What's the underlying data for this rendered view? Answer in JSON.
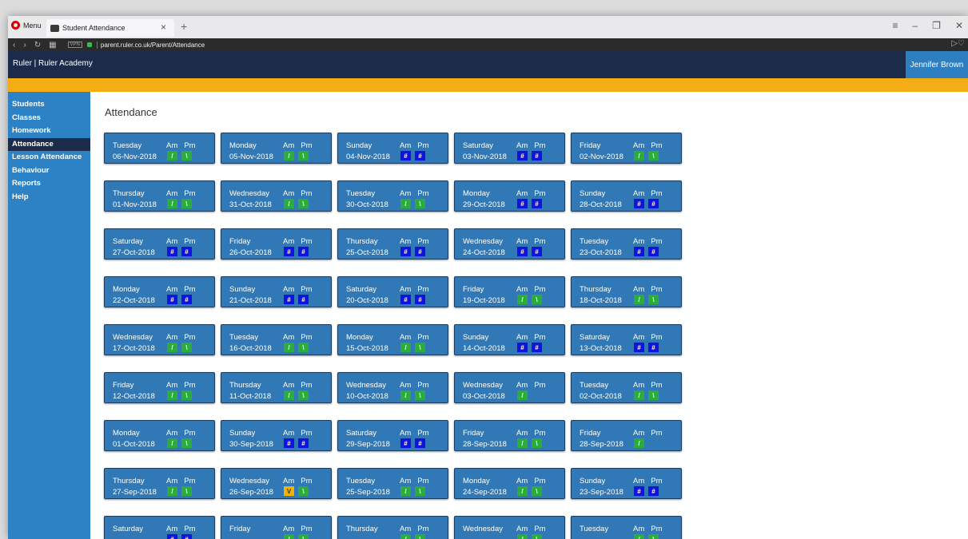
{
  "browser": {
    "menu_label": "Menu",
    "tab_title": "Student Attendance",
    "close_glyph": "×",
    "new_tab_glyph": "+",
    "url": "parent.ruler.co.uk/Parent/Attendance",
    "vpn_label": "VPN"
  },
  "app": {
    "brand": "Ruler | Ruler Academy",
    "user": "Jennifer Brown",
    "accent_color": "#f5ad16",
    "header_color": "#1d2b4a",
    "sidebar_color": "#2d82c6"
  },
  "sidebar": {
    "items": [
      {
        "label": "Students"
      },
      {
        "label": "Classes"
      },
      {
        "label": "Homework"
      },
      {
        "label": "Attendance",
        "active": true
      },
      {
        "label": "Lesson Attendance"
      },
      {
        "label": "Behaviour"
      },
      {
        "label": "Reports"
      },
      {
        "label": "Help"
      }
    ]
  },
  "page": {
    "title": "Attendance",
    "am_label": "Am",
    "pm_label": "Pm"
  },
  "cards": [
    {
      "day": "Tuesday",
      "date": "06-Nov-2018",
      "am": "/",
      "pm": "\\"
    },
    {
      "day": "Monday",
      "date": "05-Nov-2018",
      "am": "/",
      "pm": "\\"
    },
    {
      "day": "Sunday",
      "date": "04-Nov-2018",
      "am": "#",
      "pm": "#"
    },
    {
      "day": "Saturday",
      "date": "03-Nov-2018",
      "am": "#",
      "pm": "#"
    },
    {
      "day": "Friday",
      "date": "02-Nov-2018",
      "am": "/",
      "pm": "\\"
    },
    {
      "day": "Thursday",
      "date": "01-Nov-2018",
      "am": "/",
      "pm": "\\"
    },
    {
      "day": "Wednesday",
      "date": "31-Oct-2018",
      "am": "/",
      "pm": "\\"
    },
    {
      "day": "Tuesday",
      "date": "30-Oct-2018",
      "am": "/",
      "pm": "\\"
    },
    {
      "day": "Monday",
      "date": "29-Oct-2018",
      "am": "#",
      "pm": "#"
    },
    {
      "day": "Sunday",
      "date": "28-Oct-2018",
      "am": "#",
      "pm": "#"
    },
    {
      "day": "Saturday",
      "date": "27-Oct-2018",
      "am": "#",
      "pm": "#"
    },
    {
      "day": "Friday",
      "date": "26-Oct-2018",
      "am": "#",
      "pm": "#"
    },
    {
      "day": "Thursday",
      "date": "25-Oct-2018",
      "am": "#",
      "pm": "#"
    },
    {
      "day": "Wednesday",
      "date": "24-Oct-2018",
      "am": "#",
      "pm": "#"
    },
    {
      "day": "Tuesday",
      "date": "23-Oct-2018",
      "am": "#",
      "pm": "#"
    },
    {
      "day": "Monday",
      "date": "22-Oct-2018",
      "am": "#",
      "pm": "#"
    },
    {
      "day": "Sunday",
      "date": "21-Oct-2018",
      "am": "#",
      "pm": "#"
    },
    {
      "day": "Saturday",
      "date": "20-Oct-2018",
      "am": "#",
      "pm": "#"
    },
    {
      "day": "Friday",
      "date": "19-Oct-2018",
      "am": "/",
      "pm": "\\"
    },
    {
      "day": "Thursday",
      "date": "18-Oct-2018",
      "am": "/",
      "pm": "\\"
    },
    {
      "day": "Wednesday",
      "date": "17-Oct-2018",
      "am": "/",
      "pm": "\\"
    },
    {
      "day": "Tuesday",
      "date": "16-Oct-2018",
      "am": "/",
      "pm": "\\"
    },
    {
      "day": "Monday",
      "date": "15-Oct-2018",
      "am": "/",
      "pm": "\\"
    },
    {
      "day": "Sunday",
      "date": "14-Oct-2018",
      "am": "#",
      "pm": "#"
    },
    {
      "day": "Saturday",
      "date": "13-Oct-2018",
      "am": "#",
      "pm": "#"
    },
    {
      "day": "Friday",
      "date": "12-Oct-2018",
      "am": "/",
      "pm": "\\"
    },
    {
      "day": "Thursday",
      "date": "11-Oct-2018",
      "am": "/",
      "pm": "\\"
    },
    {
      "day": "Wednesday",
      "date": "10-Oct-2018",
      "am": "/",
      "pm": "\\"
    },
    {
      "day": "Wednesday",
      "date": "03-Oct-2018",
      "am": "/",
      "pm": ""
    },
    {
      "day": "Tuesday",
      "date": "02-Oct-2018",
      "am": "/",
      "pm": "\\"
    },
    {
      "day": "Monday",
      "date": "01-Oct-2018",
      "am": "/",
      "pm": "\\"
    },
    {
      "day": "Sunday",
      "date": "30-Sep-2018",
      "am": "#",
      "pm": "#"
    },
    {
      "day": "Saturday",
      "date": "29-Sep-2018",
      "am": "#",
      "pm": "#"
    },
    {
      "day": "Friday",
      "date": "28-Sep-2018",
      "am": "/",
      "pm": "\\"
    },
    {
      "day": "Friday",
      "date": "28-Sep-2018",
      "am": "/",
      "pm": ""
    },
    {
      "day": "Thursday",
      "date": "27-Sep-2018",
      "am": "/",
      "pm": "\\"
    },
    {
      "day": "Wednesday",
      "date": "26-Sep-2018",
      "am": "V",
      "pm": "\\"
    },
    {
      "day": "Tuesday",
      "date": "25-Sep-2018",
      "am": "/",
      "pm": "\\"
    },
    {
      "day": "Monday",
      "date": "24-Sep-2018",
      "am": "/",
      "pm": "\\"
    },
    {
      "day": "Sunday",
      "date": "23-Sep-2018",
      "am": "#",
      "pm": "#"
    },
    {
      "day": "Saturday",
      "date": "",
      "am": "#",
      "pm": "#"
    },
    {
      "day": "Friday",
      "date": "",
      "am": "/",
      "pm": "\\"
    },
    {
      "day": "Thursday",
      "date": "",
      "am": "/",
      "pm": "\\"
    },
    {
      "day": "Wednesday",
      "date": "",
      "am": "/",
      "pm": "\\"
    },
    {
      "day": "Tuesday",
      "date": "",
      "am": "/",
      "pm": "\\"
    }
  ],
  "mark_colors": {
    "/": "#2cac3a",
    "\\": "#2cac3a",
    "#": "#1111e0",
    "V": "#f0b400"
  }
}
